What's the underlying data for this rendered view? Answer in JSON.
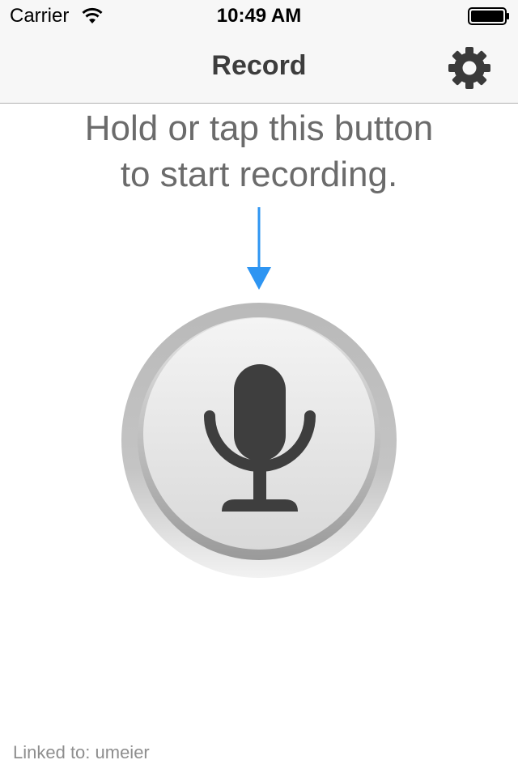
{
  "status_bar": {
    "carrier": "Carrier",
    "time": "10:49 AM",
    "wifi_icon": "wifi-icon",
    "battery_icon": "battery-icon"
  },
  "nav_bar": {
    "title": "Record",
    "settings_icon": "gear-icon"
  },
  "instruction": {
    "line1": "Hold or tap this button",
    "line2": "to start recording."
  },
  "record_button": {
    "icon": "microphone-icon"
  },
  "footer": {
    "linked_to": "Linked to: umeier"
  },
  "colors": {
    "arrow": "#2e95f2",
    "mic": "#3e3e3e",
    "text_gray": "#6b6b6b",
    "nav_background": "#f7f7f7"
  }
}
